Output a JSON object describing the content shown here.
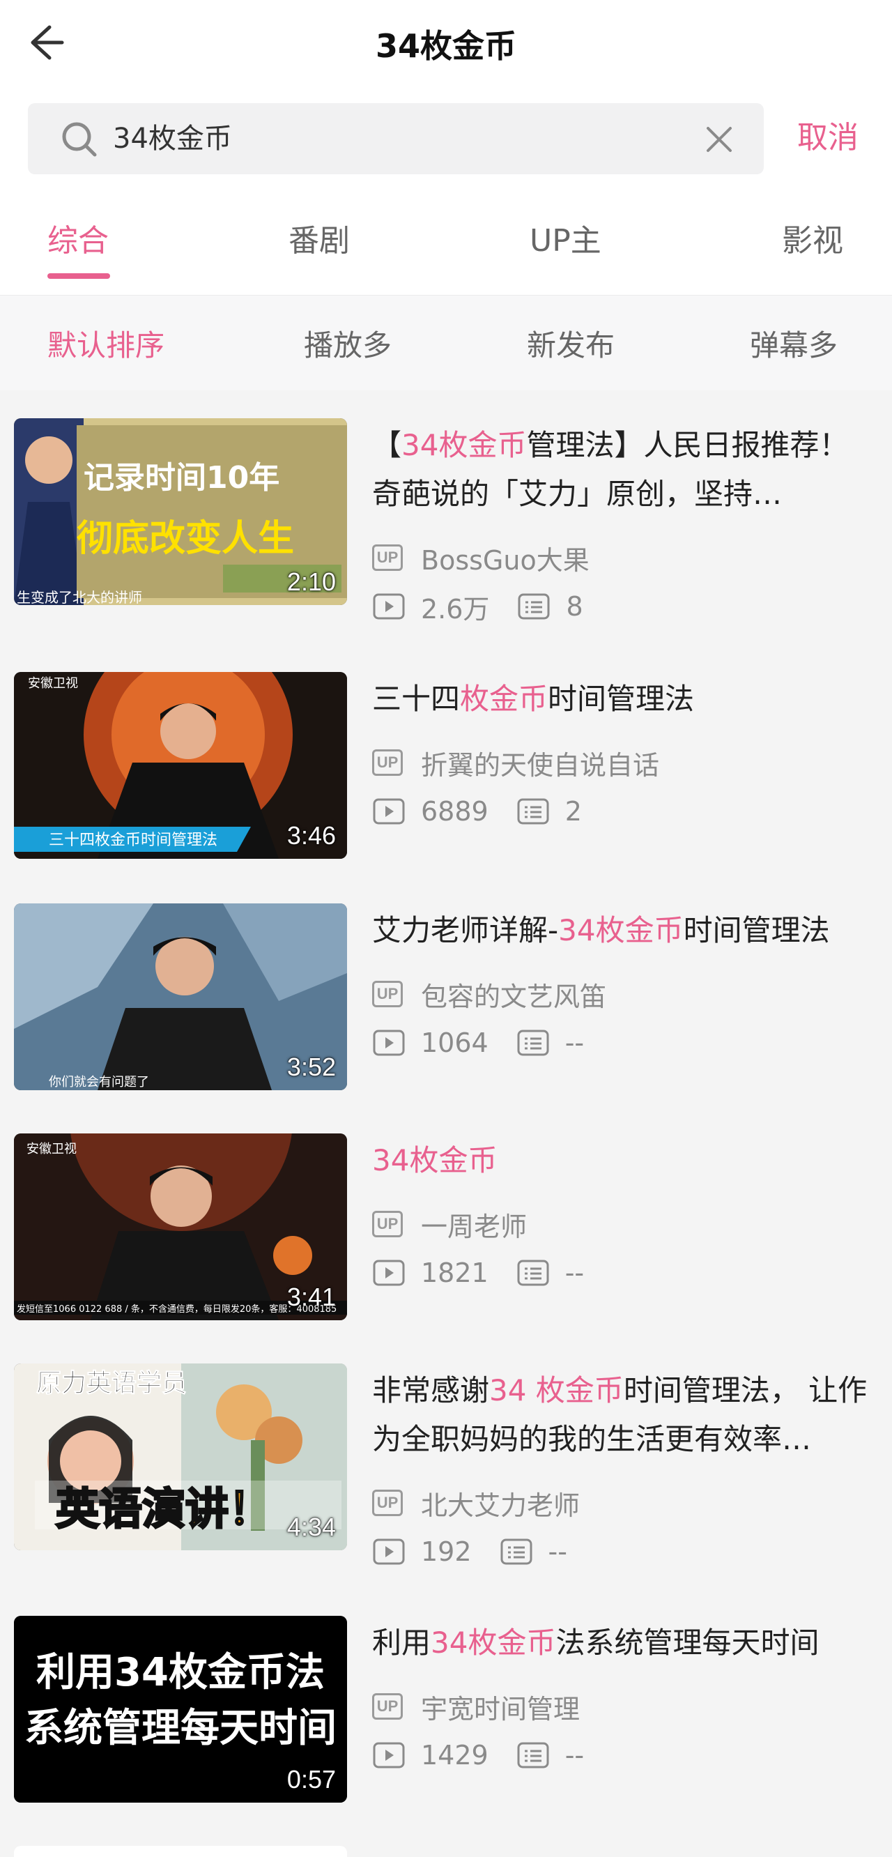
{
  "header": {
    "title": "34枚金币"
  },
  "search": {
    "query": "34枚金币",
    "cancel_label": "取消"
  },
  "tabs": [
    {
      "label": "综合",
      "active": true
    },
    {
      "label": "番剧",
      "active": false
    },
    {
      "label": "UP主",
      "active": false
    },
    {
      "label": "影视",
      "active": false
    }
  ],
  "sorts": [
    {
      "label": "默认排序",
      "active": true
    },
    {
      "label": "播放多",
      "active": false
    },
    {
      "label": "新发布",
      "active": false
    },
    {
      "label": "弹幕多",
      "active": false
    }
  ],
  "colors": {
    "accent": "#e8608e",
    "text": "#212121",
    "meta": "#8a8a8a"
  },
  "results": [
    {
      "title_parts": [
        "【",
        "34枚金币",
        "管理法】人民日报推荐！奇葩说的「艾力」原创，坚持…"
      ],
      "uploader": "BossGuo大果",
      "views": "2.6万",
      "danmaku": "8",
      "duration": "2:10",
      "thumb_text": [
        "记录时间10年",
        "彻底改变人生",
        "生变成了北大的讲师"
      ]
    },
    {
      "title_parts": [
        "三十四",
        "枚金币",
        "时间管理法"
      ],
      "uploader": "折翼的天使自说自话",
      "views": "6889",
      "danmaku": "2",
      "duration": "3:46",
      "thumb_text": [
        "安徽卫视",
        "三十四枚金币时间管理法"
      ]
    },
    {
      "title_parts": [
        "艾力老师详解-",
        "34枚金币",
        "时间管理法"
      ],
      "uploader": "包容的文艺风笛",
      "views": "1064",
      "danmaku": "--",
      "duration": "3:52",
      "thumb_text": [
        "你们就会有问题了"
      ]
    },
    {
      "title_parts": [
        "",
        "34枚金币",
        ""
      ],
      "uploader": "一周老师",
      "views": "1821",
      "danmaku": "--",
      "duration": "3:41",
      "thumb_text": [
        "安徽卫视",
        "发短信至1066 0122 688 / 条，不含通信费，每日限发20条，客服：4008185"
      ]
    },
    {
      "title_parts": [
        "非常感谢",
        "34 枚金币",
        "时间管理法， 让作为全职妈妈的我的生活更有效率…"
      ],
      "uploader": "北大艾力老师",
      "views": "192",
      "danmaku": "--",
      "duration": "4:34",
      "thumb_text": [
        "原力英语学员",
        "英语演讲！"
      ]
    },
    {
      "title_parts": [
        "利用",
        "34枚金币",
        "法系统管理每天时间"
      ],
      "uploader": "宇宽时间管理",
      "views": "1429",
      "danmaku": "--",
      "duration": "0:57",
      "thumb_text": [
        "利用34枚金币法",
        "系统管理每天时间"
      ]
    }
  ]
}
